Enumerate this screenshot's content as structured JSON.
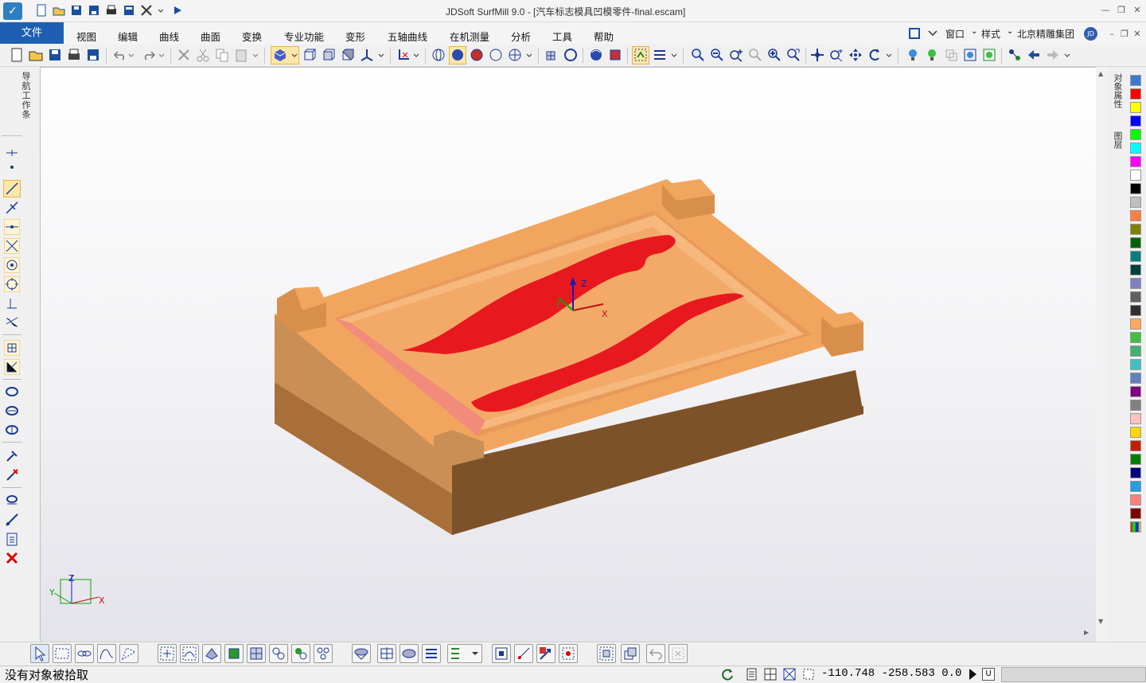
{
  "title_bar": {
    "title": "JDSoft SurfMill 9.0 - [汽车标志模具凹模零件-final.escam]",
    "window_controls": [
      "minimize-icon",
      "restore-icon",
      "close-icon"
    ]
  },
  "menu": {
    "file_tab": "文件",
    "items": [
      "视图",
      "编辑",
      "曲线",
      "曲面",
      "变换",
      "专业功能",
      "变形",
      "五轴曲线",
      "在机测量",
      "分析",
      "工具",
      "帮助"
    ],
    "right": {
      "window": "窗口",
      "style": "样式",
      "company": "北京精雕集团",
      "user_badge": "JD"
    }
  },
  "left_panel": {
    "tab_label": "导航工作条"
  },
  "right_panel": {
    "tab_labels": [
      "对象属性",
      "图层"
    ]
  },
  "viewport": {
    "axis_labels": {
      "x": "X",
      "y": "Y",
      "z": "Z"
    },
    "mold_color": "#f2a55f",
    "part_color": "#e8191e"
  },
  "palette": [
    "#ff0000",
    "#ffff00",
    "#0000ff",
    "#00ff00",
    "#00ffff",
    "#ff00ff",
    "#ffffff",
    "#000000",
    "#c0c0c0",
    "#ff8040",
    "#808000",
    "#006400",
    "#008080",
    "#004040",
    "#8080c0",
    "#606060",
    "#303030",
    "#ffa860",
    "#40c040",
    "#40b070",
    "#40c0c0",
    "#6080c0",
    "#800080",
    "#808080",
    "#ffc0c0",
    "#ffd700",
    "#c02000",
    "#008000",
    "#000080",
    "#20a0e0",
    "#ff8080",
    "#800000",
    "#multicolor"
  ],
  "status": {
    "message": "没有对象被拾取",
    "coords": "-110.748  -258.583  0.0",
    "u_label": "U"
  }
}
